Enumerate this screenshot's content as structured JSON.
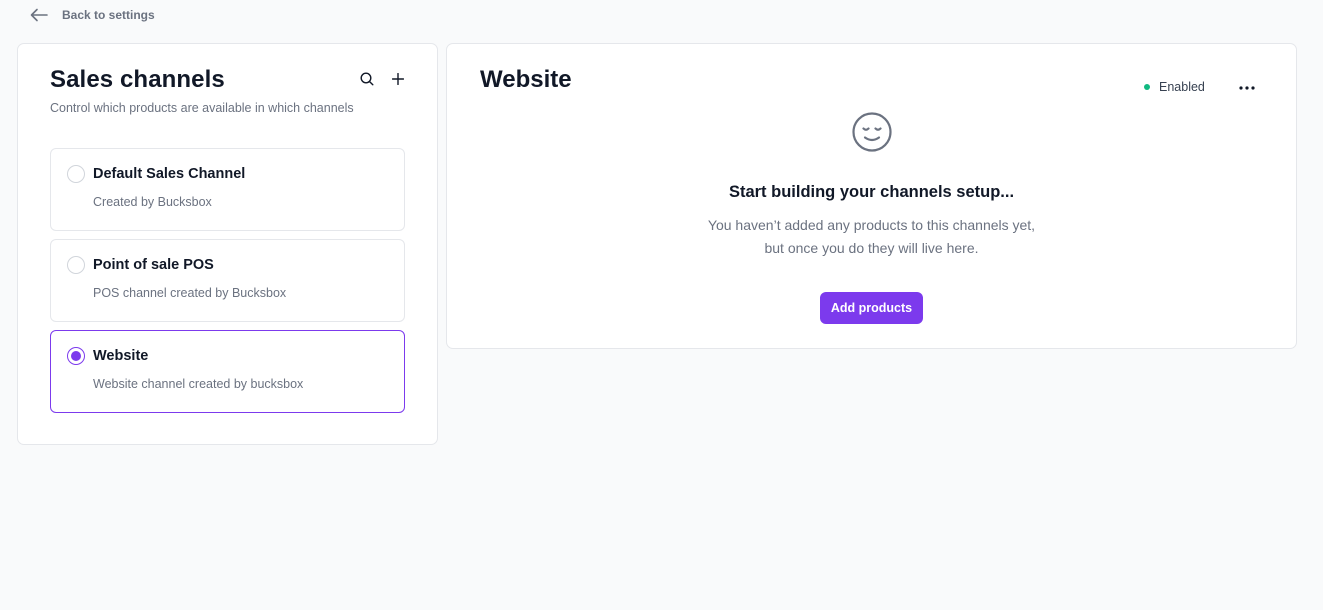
{
  "nav": {
    "back_label": "Back to settings"
  },
  "sidebar": {
    "title": "Sales channels",
    "subtitle": "Control which products are available in which channels",
    "search_icon": "search-icon",
    "add_icon": "plus-icon",
    "channels": [
      {
        "name": "Default Sales Channel",
        "description": "Created by Bucksbox",
        "selected": false
      },
      {
        "name": "Point of sale POS",
        "description": "POS channel created by Bucksbox",
        "selected": false
      },
      {
        "name": "Website",
        "description": "Website channel created by bucksbox",
        "selected": true
      }
    ]
  },
  "detail": {
    "title": "Website",
    "status": "Enabled",
    "status_color": "#10b981",
    "more_icon": "more-horizontal-icon",
    "empty_state": {
      "icon": "face-icon",
      "title": "Start building your channels setup...",
      "description_line1": "You haven’t added any products to this channels yet,",
      "description_line2": "but once you do they will live here.",
      "button_label": "Add products"
    }
  },
  "colors": {
    "accent": "#7c3aed",
    "background": "#f9fafb",
    "muted_text": "#6b7280"
  }
}
